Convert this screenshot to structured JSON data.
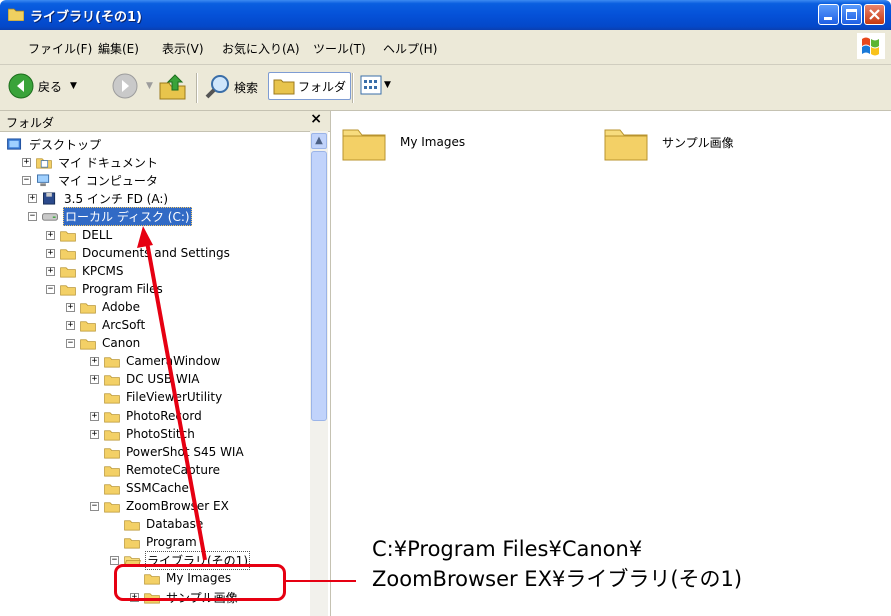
{
  "window": {
    "title": "ライブラリ(その1)",
    "title_bar_color": "#0551d8"
  },
  "menubar": {
    "items": [
      "ファイル(F)",
      "編集(E)",
      "表示(V)",
      "お気に入り(A)",
      "ツール(T)",
      "ヘルプ(H)"
    ]
  },
  "toolbar": {
    "back_label": "戻る",
    "search_label": "検索",
    "folders_label": "フォルダ"
  },
  "folder_pane": {
    "title": "フォルダ",
    "close_glyph": "×",
    "tree": [
      {
        "label": "デスクトップ",
        "level": 0,
        "expander": "",
        "icon": "desktop-icon"
      },
      {
        "label": "マイ ドキュメント",
        "level": 1,
        "expander": "+",
        "icon": "documents-icon"
      },
      {
        "label": "マイ コンピュータ",
        "level": 1,
        "expander": "-",
        "icon": "computer-icon"
      },
      {
        "label": "3.5 インチ FD (A:)",
        "level": 2,
        "expander": "+",
        "icon": "floppy-icon"
      },
      {
        "label": "ローカル ディスク (C:)",
        "level": 2,
        "expander": "-",
        "icon": "drive-icon",
        "selected": true
      },
      {
        "label": "DELL",
        "level": 3,
        "expander": "+",
        "icon": "folder-icon"
      },
      {
        "label": "Documents and Settings",
        "level": 3,
        "expander": "+",
        "icon": "folder-icon"
      },
      {
        "label": "KPCMS",
        "level": 3,
        "expander": "+",
        "icon": "folder-icon"
      },
      {
        "label": "Program Files",
        "level": 3,
        "expander": "-",
        "icon": "folder-icon"
      },
      {
        "label": "Adobe",
        "level": 4,
        "expander": "+",
        "icon": "folder-icon"
      },
      {
        "label": "ArcSoft",
        "level": 4,
        "expander": "+",
        "icon": "folder-icon"
      },
      {
        "label": "Canon",
        "level": 4,
        "expander": "-",
        "icon": "folder-icon"
      },
      {
        "label": "CameraWindow",
        "level": 5,
        "expander": "+",
        "icon": "folder-icon"
      },
      {
        "label": "DC USB WIA",
        "level": 5,
        "expander": "+",
        "icon": "folder-icon"
      },
      {
        "label": "FileViewerUtility",
        "level": 5,
        "expander": "",
        "icon": "folder-icon"
      },
      {
        "label": "PhotoRecord",
        "level": 5,
        "expander": "+",
        "icon": "folder-icon"
      },
      {
        "label": "PhotoStitch",
        "level": 5,
        "expander": "+",
        "icon": "folder-icon"
      },
      {
        "label": "PowerShot S45 WIA",
        "level": 5,
        "expander": "",
        "icon": "folder-icon"
      },
      {
        "label": "RemoteCapture",
        "level": 5,
        "expander": "",
        "icon": "folder-icon"
      },
      {
        "label": "SSMCache",
        "level": 5,
        "expander": "",
        "icon": "folder-icon"
      },
      {
        "label": "ZoomBrowser EX",
        "level": 5,
        "expander": "-",
        "icon": "folder-icon"
      },
      {
        "label": "Database",
        "level": 6,
        "expander": "",
        "icon": "folder-icon"
      },
      {
        "label": "Program",
        "level": 6,
        "expander": "",
        "icon": "folder-icon"
      },
      {
        "label": "ライブラリ(その1)",
        "level": 6,
        "expander": "-",
        "icon": "open-folder-icon"
      },
      {
        "label": "My Images",
        "level": 7,
        "expander": "",
        "icon": "folder-icon"
      },
      {
        "label": "サンプル画像",
        "level": 7,
        "expander": "+",
        "icon": "folder-icon"
      }
    ]
  },
  "content": {
    "items": [
      {
        "label": "My Images"
      },
      {
        "label": "サンプル画像"
      }
    ]
  },
  "annotation": {
    "line1": "C:¥Program Files¥Canon¥",
    "line2": "ZoomBrowser EX¥ライブラリ(その1)",
    "color": "#e60012"
  }
}
